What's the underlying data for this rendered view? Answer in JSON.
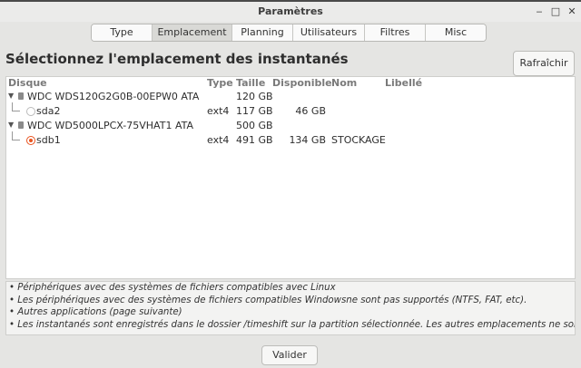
{
  "window": {
    "title": "Paramètres"
  },
  "tabs": [
    {
      "label": "Type"
    },
    {
      "label": "Emplacement"
    },
    {
      "label": "Planning"
    },
    {
      "label": "Utilisateurs"
    },
    {
      "label": "Filtres"
    },
    {
      "label": "Misc"
    }
  ],
  "heading": "Sélectionnez l'emplacement des instantanés",
  "refresh_label": "Rafraîchir",
  "table": {
    "headers": {
      "disk": "Disque",
      "type": "Type",
      "size": "Taille",
      "available": "Disponible",
      "name": "Nom",
      "label": "Libellé"
    },
    "rows": [
      {
        "disk": "WDC WDS120G2G0B-00EPW0 ATA",
        "type": "",
        "size": "120 GB",
        "available": "",
        "name": ""
      },
      {
        "disk": "sda2",
        "type": "ext4",
        "size": "117 GB",
        "available": "46 GB",
        "name": ""
      },
      {
        "disk": "WDC WD5000LPCX-75VHAT1 ATA",
        "type": "",
        "size": "500 GB",
        "available": "",
        "name": ""
      },
      {
        "disk": "sdb1",
        "type": "ext4",
        "size": "491 GB",
        "available": "134 GB",
        "name": "STOCKAGE"
      }
    ]
  },
  "notes": [
    "• Périphériques avec des systèmes de fichiers compatibles avec Linux",
    "• Les périphériques avec des systèmes de fichiers compatibles Windowsne sont pas supportés (NTFS, FAT, etc).",
    "• Autres applications (page suivante)",
    "• Les instantanés sont enregistrés dans le dossier /timeshift sur la partition sélectionnée. Les autres emplacements ne sont pas"
  ],
  "validate_label": "Valider",
  "colors": {
    "accent": "#e95420"
  }
}
